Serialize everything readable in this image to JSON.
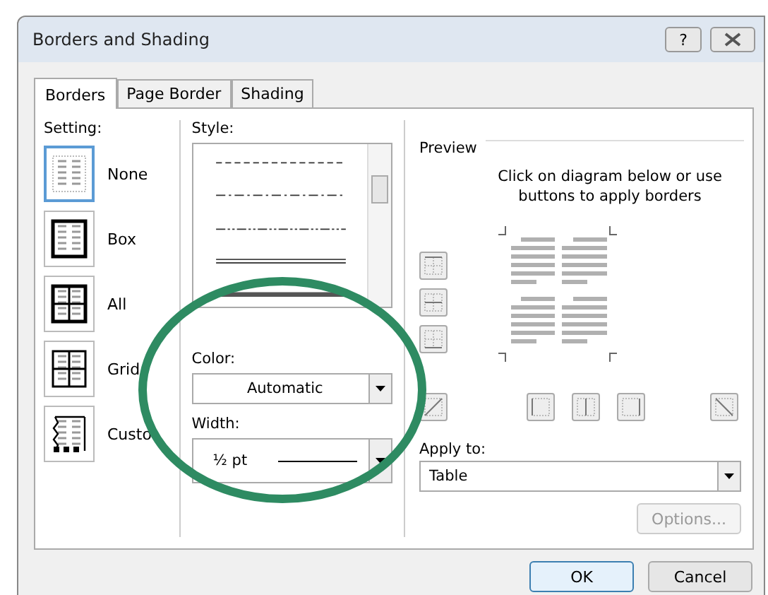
{
  "window": {
    "title": "Borders and Shading",
    "help": "?"
  },
  "tabs": [
    {
      "label": "Borders",
      "selected": true
    },
    {
      "label": "Page Border",
      "selected": false
    },
    {
      "label": "Shading",
      "selected": false
    }
  ],
  "setting": {
    "label": "Setting:",
    "items": [
      {
        "label": "None",
        "kind": "none",
        "selected": true
      },
      {
        "label": "Box",
        "kind": "box",
        "selected": false
      },
      {
        "label": "All",
        "kind": "all",
        "selected": false
      },
      {
        "label": "Grid",
        "kind": "grid",
        "selected": false
      },
      {
        "label": "Custo",
        "kind": "custom",
        "selected": false
      }
    ]
  },
  "style": {
    "label": "Style:",
    "lines": [
      {
        "kind": "dashed"
      },
      {
        "kind": "dashdot"
      },
      {
        "kind": "dashdotdot"
      },
      {
        "kind": "double"
      },
      {
        "kind": "thick"
      }
    ]
  },
  "color": {
    "label": "Color:",
    "value": "Automatic"
  },
  "width": {
    "label": "Width:",
    "value": "½ pt"
  },
  "preview": {
    "title": "Preview",
    "hint": "Click on diagram below or use buttons to apply borders",
    "side_buttons": [
      {
        "kind": "top"
      },
      {
        "kind": "middle"
      },
      {
        "kind": "bottom"
      }
    ],
    "bottom_buttons": [
      {
        "kind": "diag-up"
      },
      {
        "kind": "left"
      },
      {
        "kind": "center"
      },
      {
        "kind": "right"
      },
      {
        "kind": "diag-down"
      }
    ]
  },
  "apply_to": {
    "label": "Apply to:",
    "value": "Table"
  },
  "options_button": {
    "label": "Options...",
    "disabled": true
  },
  "buttons": [
    {
      "label": "OK",
      "default": true
    },
    {
      "label": "Cancel",
      "default": false
    }
  ]
}
